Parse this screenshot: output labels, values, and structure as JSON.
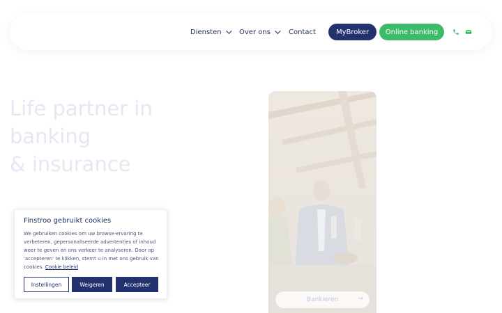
{
  "nav": {
    "items": [
      {
        "label": "Diensten",
        "has_dropdown": true
      },
      {
        "label": "Over ons",
        "has_dropdown": true
      },
      {
        "label": "Contact",
        "has_dropdown": false
      }
    ],
    "mybroker_label": "MyBroker",
    "online_banking_label": "Online banking",
    "phone_icon": "phone-icon",
    "mail_icon": "mail-icon"
  },
  "hero": {
    "title_line1": "Life partner in banking",
    "title_line2": "& insurance",
    "bank_button_label": "Bankieren"
  },
  "cookie": {
    "title": "Finstroo gebruikt cookies",
    "text": "We gebruiken cookies om uw browse-ervaring te verbeteren, gepersonaliseerde advertenties of inhoud weer te geven en ons verkeer te analyseren. Door op 'accepteren' te klikken, stemt u in met ons gebruik van cookies.",
    "link_label": "Cookie beleid",
    "settings_label": "Instellingen",
    "reject_label": "Weigeren",
    "accept_label": "Accepteer"
  },
  "colors": {
    "navy": "#23316e",
    "green": "#3dbb6a",
    "text": "#1d2b5e",
    "hero_title": "#e4e8f2"
  }
}
